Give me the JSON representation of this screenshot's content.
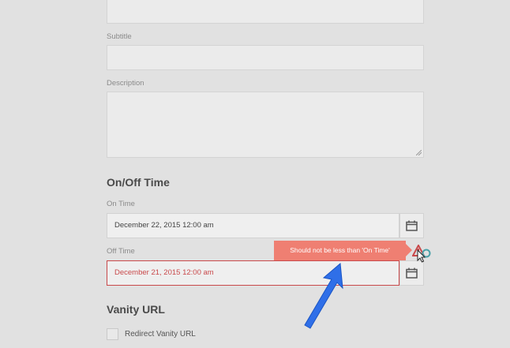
{
  "form": {
    "subtitle_label": "Subtitle",
    "subtitle_value": "",
    "description_label": "Description",
    "description_value": "",
    "on_off_section": "On/Off Time",
    "on_time_label": "On Time",
    "on_time_value": "December 22, 2015 12:00 am",
    "off_time_label": "Off Time",
    "off_time_value": "December 21, 2015 12:00 am",
    "error_tooltip": "Should not be less than 'On Time'",
    "vanity_section": "Vanity URL",
    "redirect_label": "Redirect Vanity URL"
  },
  "colors": {
    "error": "#c9494b",
    "tooltip_bg": "#ef7f72",
    "annotation_arrow": "#2f6fe8"
  },
  "icons": [
    "calendar-icon",
    "alert-icon",
    "cursor-pointer-icon",
    "annotation-arrow-icon"
  ]
}
